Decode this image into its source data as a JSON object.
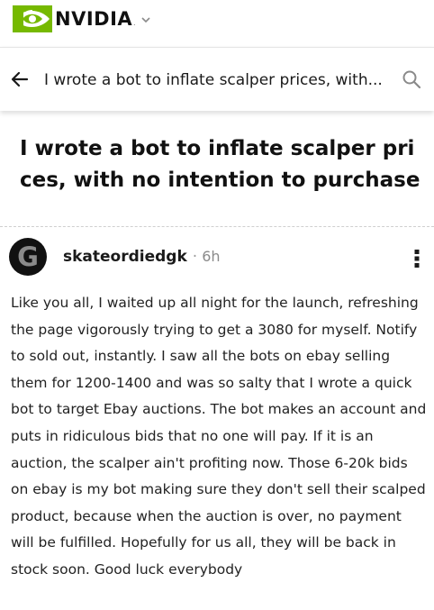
{
  "header": {
    "brand": "NVIDIA",
    "trademark": ".",
    "brand_color": "#76b900",
    "brand_icon": "nvidia-eye-logo",
    "dropdown_icon": "chevron-down-icon"
  },
  "nav": {
    "back_icon": "arrow-left-icon",
    "title": "I wrote a bot to inflate scalper prices, with...",
    "search_icon": "search-icon"
  },
  "post": {
    "title": "I wrote a bot to inflate scalper prices, with no intention to purchase",
    "author": {
      "avatar_letter": "G",
      "username": "skateordiedgk",
      "separator": "·",
      "time": "6h"
    },
    "menu_icon": "more-vertical-icon",
    "body": "Like you all, I waited up all night for the launch, refreshing the page vigorously trying to get a 3080 for myself. Notify to sold out, instantly. I saw all the bots on ebay selling them for 1200-1400 and was so salty that I wrote a quick bot to target Ebay auctions. The bot makes an account and puts in ridiculous bids that no one will pay. If it is an auction, the scalper ain't profiting now. Those 6-20k bids on ebay is my bot making sure they don't sell their scalped product, because when the auction is over, no payment will be fulfilled. Hopefully for us all, they will be back in stock soon. Good luck everybody"
  }
}
